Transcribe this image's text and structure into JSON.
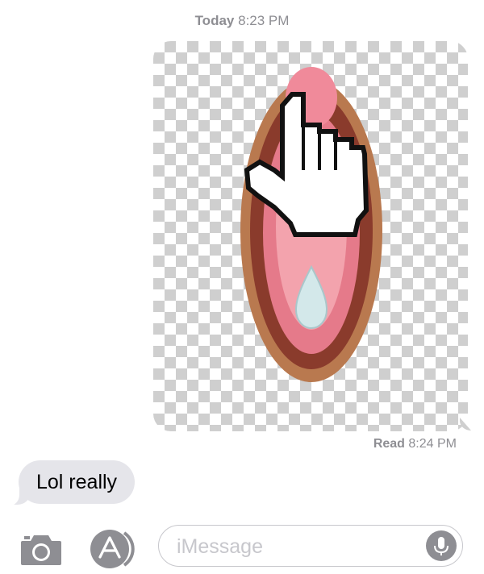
{
  "conversation": {
    "timestamp_day": "Today",
    "timestamp_time": "8:23 PM",
    "sent_image": {
      "description_icon": "mouth-cursor-sticker"
    },
    "read_label": "Read",
    "read_time": "8:24 PM",
    "received_message": "Lol really"
  },
  "composer": {
    "camera_icon": "camera-icon",
    "appstore_icon": "appstore-icon",
    "input_placeholder": "iMessage",
    "input_value": "",
    "mic_icon": "microphone-icon"
  },
  "colors": {
    "received_bubble": "#e5e5ea",
    "icon_gray": "#8e8e93",
    "checker": "#cfcfcf"
  }
}
